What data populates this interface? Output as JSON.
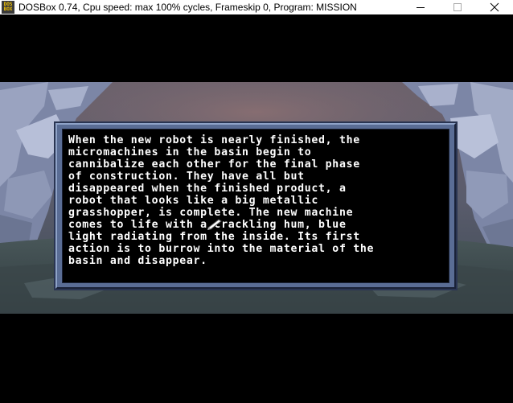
{
  "window": {
    "title": "DOSBox 0.74, Cpu speed: max 100% cycles, Frameskip  0, Program:  MISSION",
    "icon_lines": [
      "DOS",
      "BOX"
    ],
    "controls": [
      "minimize-icon",
      "maximize-icon",
      "close-icon"
    ]
  },
  "dialog": {
    "lines": [
      "When the new robot is nearly finished, the",
      "micromachines in the basin begin to",
      "cannibalize each other for the final phase",
      "of construction. They have all but",
      "disappeared when the finished product, a",
      "robot that looks like a big metallic",
      "grasshopper, is complete. The new machine",
      "comes to life with a crackling hum, blue",
      "light radiating from the inside. Its first",
      "action is to burrow into the material of the",
      "basin and disappear."
    ]
  },
  "colors": {
    "dialog_frame": "#5a6d95",
    "dialog_bg": "#000000",
    "text": "#ffffff",
    "scene_rock": "#7c86a6",
    "scene_ground": "#3e4d50"
  }
}
